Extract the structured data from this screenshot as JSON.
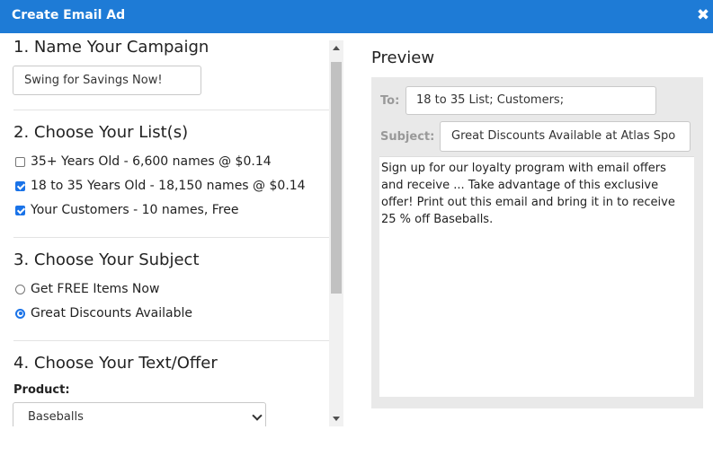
{
  "window": {
    "title": "Create Email Ad",
    "close_icon": "close-icon"
  },
  "steps": {
    "name": {
      "title": "1. Name Your Campaign",
      "campaign_value": "Swing for Savings Now!"
    },
    "lists": {
      "title": "2. Choose Your List(s)",
      "options": [
        {
          "label": "35+ Years Old - 6,600 names @ $0.14",
          "checked": false
        },
        {
          "label": "18 to 35 Years Old - 18,150 names @ $0.14",
          "checked": true
        },
        {
          "label": "Your Customers - 10 names, Free",
          "checked": true
        }
      ]
    },
    "subject": {
      "title": "3. Choose Your Subject",
      "options": [
        {
          "label": "Get FREE Items Now",
          "selected": false
        },
        {
          "label": "Great Discounts Available",
          "selected": true
        }
      ]
    },
    "offer": {
      "title": "4. Choose Your Text/Offer",
      "product_label": "Product:",
      "product_value": "Baseballs"
    }
  },
  "preview": {
    "title": "Preview",
    "to_label": "To:",
    "to_value": "18 to 35 List; Customers;",
    "subject_label": "Subject:",
    "subject_value": "Great Discounts Available at Atlas Spo",
    "body": "Sign up for our loyalty program with email offers and receive ... Take advantage of this exclusive offer! Print out this email and bring it in to receive 25 % off Baseballs."
  },
  "colors": {
    "titlebar": "#1e7bd6",
    "accent": "#1a73e8",
    "preview_bg": "#e9e9e9"
  }
}
